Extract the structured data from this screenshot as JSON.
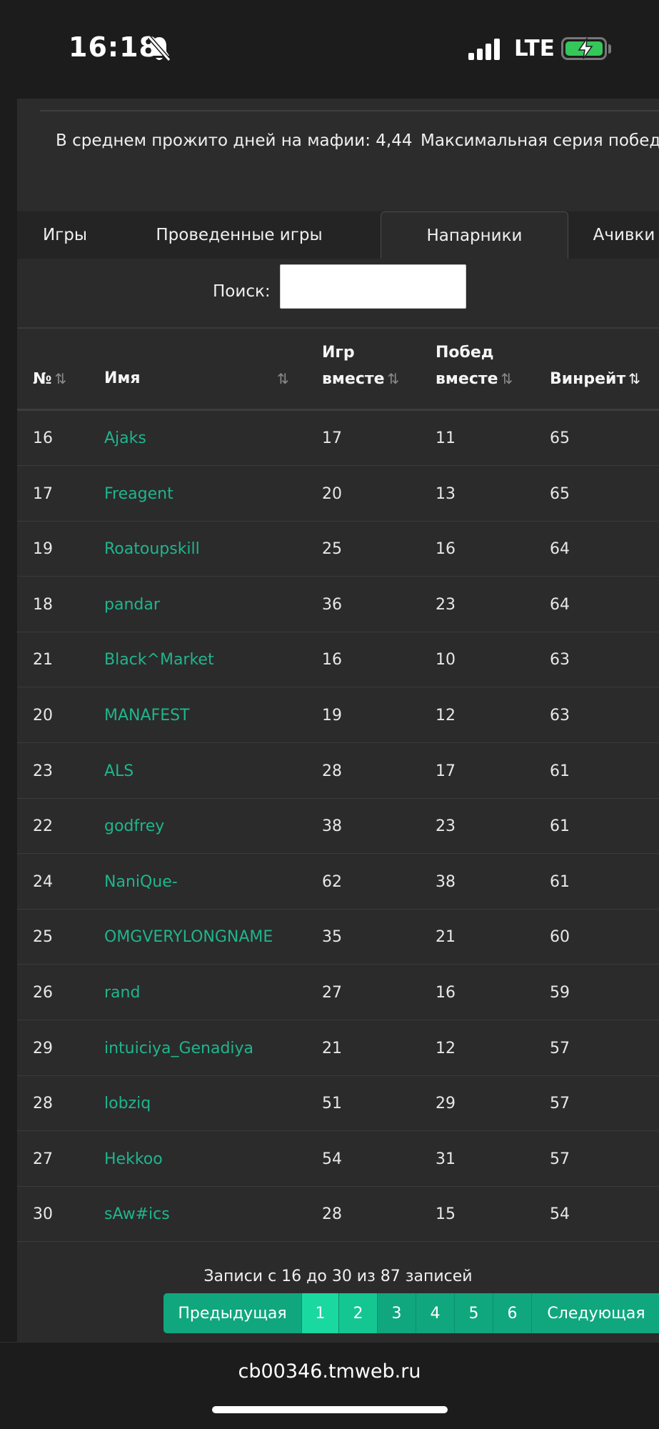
{
  "status_bar": {
    "time": "16:18",
    "network": "LTE",
    "icons": [
      "bell-slash-icon",
      "signal-icon",
      "battery-charging-icon"
    ]
  },
  "stats": {
    "avg_days_mafia": "В среднем прожито дней на мафии: 4,44",
    "max_win_streak": "Максимальная серия побед:"
  },
  "tabs": [
    {
      "label": "Игры",
      "active": false
    },
    {
      "label": "Проведенные игры",
      "active": false
    },
    {
      "label": "Напарники",
      "active": true
    },
    {
      "label": "Ачивки",
      "active": false
    }
  ],
  "search": {
    "label": "Поиск:",
    "value": ""
  },
  "table": {
    "headers": {
      "num": "№",
      "name": "Имя",
      "games_l1": "Игр",
      "games_l2": "вместе",
      "wins_l1": "Побед",
      "wins_l2": "вместе",
      "winrate": "Винрейт"
    },
    "sort": {
      "active_column": "winrate",
      "direction": "desc"
    },
    "rows": [
      {
        "num": "16",
        "name": "Ajaks",
        "games": "17",
        "wins": "11",
        "winrate": "65"
      },
      {
        "num": "17",
        "name": "Freagent",
        "games": "20",
        "wins": "13",
        "winrate": "65"
      },
      {
        "num": "19",
        "name": "Roatoupskill",
        "games": "25",
        "wins": "16",
        "winrate": "64"
      },
      {
        "num": "18",
        "name": "pandar",
        "games": "36",
        "wins": "23",
        "winrate": "64"
      },
      {
        "num": "21",
        "name": "Black^Market",
        "games": "16",
        "wins": "10",
        "winrate": "63"
      },
      {
        "num": "20",
        "name": "MANAFEST",
        "games": "19",
        "wins": "12",
        "winrate": "63"
      },
      {
        "num": "23",
        "name": "ALS",
        "games": "28",
        "wins": "17",
        "winrate": "61"
      },
      {
        "num": "22",
        "name": "godfrey",
        "games": "38",
        "wins": "23",
        "winrate": "61"
      },
      {
        "num": "24",
        "name": "NaniQue-",
        "games": "62",
        "wins": "38",
        "winrate": "61"
      },
      {
        "num": "25",
        "name": "OMGVERYLONGNAME",
        "games": "35",
        "wins": "21",
        "winrate": "60"
      },
      {
        "num": "26",
        "name": "rand",
        "games": "27",
        "wins": "16",
        "winrate": "59"
      },
      {
        "num": "29",
        "name": "intuiciya_Genadiya",
        "games": "21",
        "wins": "12",
        "winrate": "57"
      },
      {
        "num": "28",
        "name": "lobziq",
        "games": "51",
        "wins": "29",
        "winrate": "57"
      },
      {
        "num": "27",
        "name": "Hekkoo",
        "games": "54",
        "wins": "31",
        "winrate": "57"
      },
      {
        "num": "30",
        "name": "sAw#ics",
        "games": "28",
        "wins": "15",
        "winrate": "54"
      }
    ]
  },
  "pagination": {
    "info": "Записи с 16 до 30 из 87 записей",
    "prev": "Предыдущая",
    "pages": [
      "1",
      "2",
      "3",
      "4",
      "5",
      "6"
    ],
    "current_page": "2",
    "next": "Следующая"
  },
  "browser": {
    "url": "cb00346.tmweb.ru"
  },
  "colors": {
    "accent": "#1fb58d",
    "pager": "#10a77e",
    "background": "#2b2b2b"
  }
}
